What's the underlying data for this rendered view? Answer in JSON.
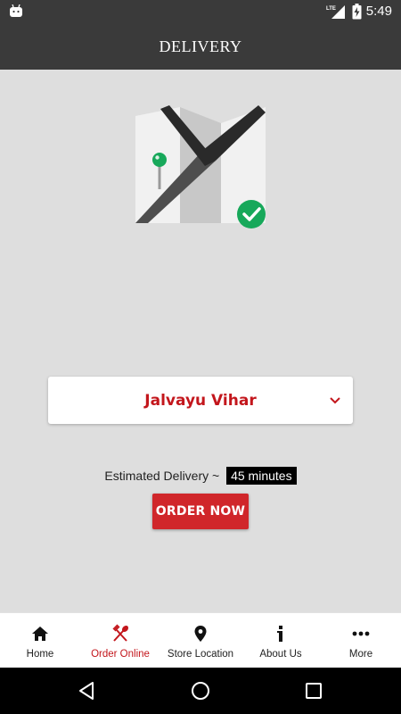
{
  "status_bar": {
    "network": "LTE",
    "time": "5:49"
  },
  "app_bar": {
    "title": "DELIVERY"
  },
  "illustration": {
    "icon": "map-pin-check-icon",
    "colors": {
      "pin": "#17a85a",
      "check": "#17a85a"
    }
  },
  "location_select": {
    "value": "Jalvayu Vihar",
    "icon": "chevron-down-icon"
  },
  "estimate": {
    "label": "Estimated Delivery ~",
    "time": "45 minutes"
  },
  "order_button": {
    "label": "ORDER NOW"
  },
  "bottom_nav": {
    "items": [
      {
        "label": "Home",
        "icon": "home-icon",
        "active": false
      },
      {
        "label": "Order Online",
        "icon": "fork-spoon-icon",
        "active": true
      },
      {
        "label": "Store Location",
        "icon": "location-pin-icon",
        "active": false
      },
      {
        "label": "About Us",
        "icon": "info-icon",
        "active": false
      },
      {
        "label": "More",
        "icon": "more-dots-icon",
        "active": false
      }
    ]
  },
  "colors": {
    "accent": "#c3161c",
    "app_bar": "#3a3a3a",
    "background": "#dedede",
    "button": "#d0262a"
  }
}
